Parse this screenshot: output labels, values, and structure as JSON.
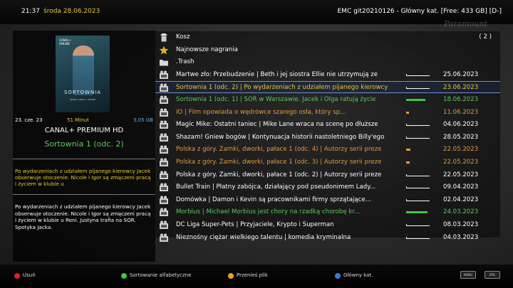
{
  "header": {
    "time": "21:37",
    "date": "środa 28.06.2023",
    "info": "EMC git20210126 - Główny kat. [Free: 433 GB] [D-]"
  },
  "watermark": "Paramount",
  "poster": {
    "brand_line1": "CANAL+",
    "brand_line2": "ONLINE",
    "title": "SORTOWNIA",
    "subtitle": "SERIAL CANAL+ ONLINE"
  },
  "details": {
    "date": "23. cze. 23",
    "duration": "51 Minut",
    "size": "3,05 GB",
    "channel": "CANAL+ PREMIUM HD",
    "program_title": "Sortownia 1 (odc. 2)",
    "short_desc": "Po wydarzeniach z udziałem pijanego kierowcy Jacek obserwuje otoczenie. Nicole i Igor są zmęczeni pracą i życiem w klubie u",
    "long_desc": "Po wydarzeniach z udziałem pijanego kierowcy Jacek obserwuje otoczenie. Nicole i Igor są zmęczeni pracą i życiem w klubie u Reni. Justyna trafia na SOR. Spotyka Jacka."
  },
  "colors": {
    "white": "#ffffff",
    "yellow": "#e8c832",
    "green": "#5cc85c",
    "orange": "#e09a3a",
    "red_key": "#e02020",
    "green_key": "#3cc83c",
    "yellow_key": "#f0a020",
    "blue_key": "#3a7ae0"
  },
  "list": [
    {
      "icon": "trash-icon",
      "name": "Kosz",
      "count": "( 2 )",
      "color": "white"
    },
    {
      "icon": "star-icon",
      "name": "Najnowsze nagrania",
      "color": "white"
    },
    {
      "icon": "folder-icon",
      "name": ".Trash",
      "color": "white"
    },
    {
      "icon": "movie-icon",
      "name": "Martwe zło: Przebudzenie | Beth i jej siostra Ellie nie utrzymują ze",
      "date": "25.06.2023",
      "progress": 0.0,
      "color": "white"
    },
    {
      "icon": "movie-icon",
      "name": "Sortownia 1 (odc. 2) | Po wydarzeniach z udziałem pijanego kierowcy",
      "date": "23.06.2023",
      "progress": 0.0,
      "color": "yellow",
      "selected": true
    },
    {
      "icon": "movie-icon",
      "name": "Sortownia 1 (odc. 1) | SOR w Warszawie. Jacek i Olga ratują życie",
      "date": "18.06.2023",
      "progress": 0.85,
      "color": "green"
    },
    {
      "icon": "movie-icon",
      "name": "IO | Film opowiada o wędrówce szarego osła, który sp...",
      "date": "11.06.2023",
      "progress": 0.12,
      "color": "orange"
    },
    {
      "icon": "movie-icon",
      "name": "Magic Mike: Ostatni taniec | Mike Lane wraca na scenę po dłuższe",
      "date": "04.06.2023",
      "progress": 0.0,
      "color": "white"
    },
    {
      "icon": "movie-icon",
      "name": "Shazam! Gniew bogów | Kontynuacja historii nastoletniego Billy'ego",
      "date": "28.05.2023",
      "progress": 0.0,
      "color": "white"
    },
    {
      "icon": "movie-icon",
      "name": "Polska z góry. Zamki, dworki, pałace 1 (odc. 4) | Autorzy serii preze",
      "date": "22.05.2023",
      "progress": 0.2,
      "color": "orange"
    },
    {
      "icon": "movie-icon",
      "name": "Polska z góry. Zamki, dworki, pałace 1 (odc. 3) | Autorzy serii preze",
      "date": "22.05.2023",
      "progress": 0.15,
      "color": "orange"
    },
    {
      "icon": "movie-icon",
      "name": "Polska z góry. Zamki, dworki, pałace 1 (odc. 2) | Autorzy serii preze",
      "date": "22.05.2023",
      "progress": 0.0,
      "color": "white"
    },
    {
      "icon": "movie-icon",
      "name": "Bullet Train | Płatny zabójca, działający pod pseudonimem Lady...",
      "date": "09.04.2023",
      "progress": 0.0,
      "color": "white"
    },
    {
      "icon": "movie-icon",
      "name": "Domówka | Damon i Kevin są pracownikami firmy sprzątające...",
      "date": "02.04.2023",
      "progress": 0.0,
      "color": "white"
    },
    {
      "icon": "movie-icon",
      "name": "Morbius | Michael Morbius jest chory na rzadką chorobę kr...",
      "date": "24.03.2023",
      "progress": 0.95,
      "color": "green"
    },
    {
      "icon": "movie-icon",
      "name": "DC Liga Super-Pets | Przyjaciele, Krypto i Superman",
      "date": "08.03.2023",
      "progress": 0.0,
      "color": "white"
    },
    {
      "icon": "movie-icon",
      "name": "Nieznośny ciężar wielkiego talentu | komedia kryminalna",
      "date": "04.03.2023",
      "progress": 0.0,
      "color": "white"
    }
  ],
  "footer": {
    "red_label": "Usuń",
    "green_label": "Sortowanie alfabetyczne",
    "yellow_label": "Przenieś plik",
    "blue_label": "Główny kat.",
    "menu_badge": "MENU",
    "epg_badge": "EPG"
  }
}
